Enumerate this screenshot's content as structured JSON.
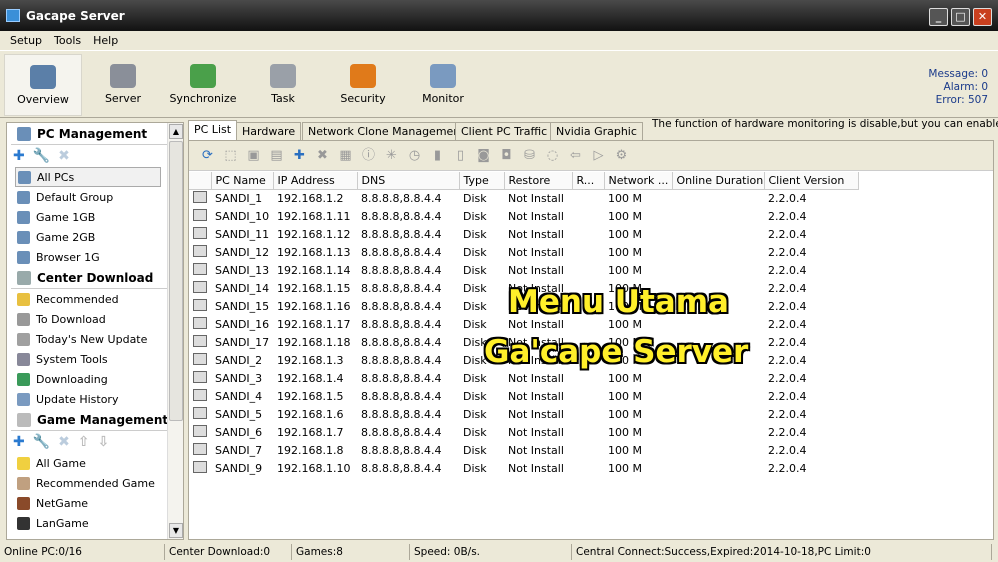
{
  "window": {
    "title": "Gacape Server"
  },
  "menu": [
    "Setup",
    "Tools",
    "Help"
  ],
  "toolbar": [
    {
      "label": "Overview",
      "icon": "overview-icon",
      "color": "#5b7fa8"
    },
    {
      "label": "Server",
      "icon": "server-icon",
      "color": "#8a8f99"
    },
    {
      "label": "Synchronize",
      "icon": "synchronize-icon",
      "color": "#4aa04a"
    },
    {
      "label": "Task",
      "icon": "task-icon",
      "color": "#9aa0a8"
    },
    {
      "label": "Security",
      "icon": "security-shield-icon",
      "color": "#e07a1a"
    },
    {
      "label": "Monitor",
      "icon": "monitor-icon",
      "color": "#7a9ac0"
    }
  ],
  "status_info": {
    "message": "Message: 0",
    "alarm": "Alarm: 0",
    "error": "Error: 507"
  },
  "sidebar": {
    "pc_management": {
      "title": "PC Management",
      "items": [
        "All PCs",
        "Default Group",
        "Game 1GB",
        "Game 2GB",
        "Browser 1G"
      ]
    },
    "center_download": {
      "title": "Center Download",
      "items": [
        "Recommended",
        "To Download",
        "Today's New Update",
        "System Tools",
        "Downloading",
        "Update History"
      ]
    },
    "game_management": {
      "title": "Game Management",
      "items": [
        "All Game",
        "Recommended Game",
        "NetGame",
        "LanGame"
      ]
    }
  },
  "tabs": [
    "PC List",
    "Hardware",
    "Network Clone Management",
    "Client PC Traffic",
    "Nvidia Graphic"
  ],
  "hardware_note": "The function of hardware monitoring is disable,but you can enable it in System Setup->Other Setup",
  "table": {
    "columns": [
      "PC Name",
      "IP Address",
      "DNS",
      "Type",
      "Restore",
      "R...",
      "Network ...",
      "Online Duration",
      "Client Version"
    ],
    "rows": [
      [
        "SANDI_1",
        "192.168.1.2",
        "8.8.8.8,8.8.4.4",
        "Disk",
        "Not Install",
        "",
        "100 M",
        "",
        "2.2.0.4"
      ],
      [
        "SANDI_10",
        "192.168.1.11",
        "8.8.8.8,8.8.4.4",
        "Disk",
        "Not Install",
        "",
        "100 M",
        "",
        "2.2.0.4"
      ],
      [
        "SANDI_11",
        "192.168.1.12",
        "8.8.8.8,8.8.4.4",
        "Disk",
        "Not Install",
        "",
        "100 M",
        "",
        "2.2.0.4"
      ],
      [
        "SANDI_12",
        "192.168.1.13",
        "8.8.8.8,8.8.4.4",
        "Disk",
        "Not Install",
        "",
        "100 M",
        "",
        "2.2.0.4"
      ],
      [
        "SANDI_13",
        "192.168.1.14",
        "8.8.8.8,8.8.4.4",
        "Disk",
        "Not Install",
        "",
        "100 M",
        "",
        "2.2.0.4"
      ],
      [
        "SANDI_14",
        "192.168.1.15",
        "8.8.8.8,8.8.4.4",
        "Disk",
        "Not Install",
        "",
        "100 M",
        "",
        "2.2.0.4"
      ],
      [
        "SANDI_15",
        "192.168.1.16",
        "8.8.8.8,8.8.4.4",
        "Disk",
        "Not Install",
        "",
        "100 M",
        "",
        "2.2.0.4"
      ],
      [
        "SANDI_16",
        "192.168.1.17",
        "8.8.8.8,8.8.4.4",
        "Disk",
        "Not Install",
        "",
        "100 M",
        "",
        "2.2.0.4"
      ],
      [
        "SANDI_17",
        "192.168.1.18",
        "8.8.8.8,8.8.4.4",
        "Disk",
        "Not Install",
        "",
        "100 M",
        "",
        "2.2.0.4"
      ],
      [
        "SANDI_2",
        "192.168.1.3",
        "8.8.8.8,8.8.4.4",
        "Disk",
        "Not Install",
        "",
        "100 M",
        "",
        "2.2.0.4"
      ],
      [
        "SANDI_3",
        "192.168.1.4",
        "8.8.8.8,8.8.4.4",
        "Disk",
        "Not Install",
        "",
        "100 M",
        "",
        "2.2.0.4"
      ],
      [
        "SANDI_4",
        "192.168.1.5",
        "8.8.8.8,8.8.4.4",
        "Disk",
        "Not Install",
        "",
        "100 M",
        "",
        "2.2.0.4"
      ],
      [
        "SANDI_5",
        "192.168.1.6",
        "8.8.8.8,8.8.4.4",
        "Disk",
        "Not Install",
        "",
        "100 M",
        "",
        "2.2.0.4"
      ],
      [
        "SANDI_6",
        "192.168.1.7",
        "8.8.8.8,8.8.4.4",
        "Disk",
        "Not Install",
        "",
        "100 M",
        "",
        "2.2.0.4"
      ],
      [
        "SANDI_7",
        "192.168.1.8",
        "8.8.8.8,8.8.4.4",
        "Disk",
        "Not Install",
        "",
        "100 M",
        "",
        "2.2.0.4"
      ],
      [
        "SANDI_9",
        "192.168.1.10",
        "8.8.8.8,8.8.4.4",
        "Disk",
        "Not Install",
        "",
        "100 M",
        "",
        "2.2.0.4"
      ]
    ]
  },
  "statusbar": [
    "Online PC:0/16",
    "Center Download:0",
    "Games:8",
    "Speed: 0B/s.",
    "Central Connect:Success,Expired:2014-10-18,PC Limit:0"
  ],
  "overlay": {
    "line1": "Menu Utama",
    "line2": "Ga'cape Server",
    "color": "#ffef2a"
  }
}
